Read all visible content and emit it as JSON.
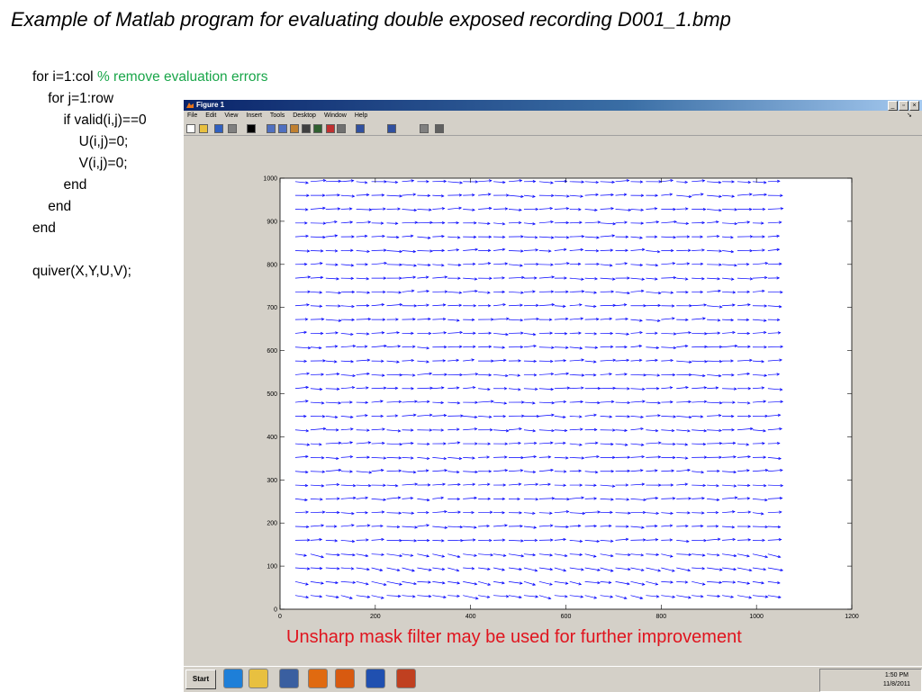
{
  "slide": {
    "title": "Example of Matlab program for evaluating double exposed recording D001_1.bmp",
    "code_lines": [
      {
        "indent": "",
        "text": "for i=1:col ",
        "comment": "% remove evaluation errors"
      },
      {
        "indent": "    ",
        "text": "for j=1:row",
        "comment": ""
      },
      {
        "indent": "        ",
        "text": "if valid(i,j)==0",
        "comment": ""
      },
      {
        "indent": "            ",
        "text": "U(i,j)=0;",
        "comment": ""
      },
      {
        "indent": "            ",
        "text": "V(i,j)=0;",
        "comment": ""
      },
      {
        "indent": "        ",
        "text": "end",
        "comment": ""
      },
      {
        "indent": "    ",
        "text": "end",
        "comment": ""
      },
      {
        "indent": "",
        "text": "end",
        "comment": ""
      },
      {
        "indent": "",
        "text": "",
        "comment": ""
      },
      {
        "indent": "",
        "text": "quiver(X,Y,U,V);",
        "comment": ""
      }
    ],
    "caption": "Unsharp mask filter may be used for further improvement"
  },
  "window": {
    "title": "Figure 1",
    "menu": [
      "File",
      "Edit",
      "View",
      "Insert",
      "Tools",
      "Desktop",
      "Window",
      "Help"
    ],
    "toolbar_icons": [
      "new-figure-icon",
      "open-file-icon",
      "save-icon",
      "print-icon",
      "edit-plot-icon",
      "zoom-in-icon",
      "zoom-out-icon",
      "pan-icon",
      "rotate-3d-icon",
      "data-cursor-icon",
      "brush-icon",
      "link-icon",
      "colorbar-icon",
      "legend-icon",
      "hide-plot-tools-icon",
      "show-plot-tools-icon"
    ]
  },
  "chart_data": {
    "type": "quiver",
    "xlim": [
      0,
      1200
    ],
    "ylim": [
      0,
      1000
    ],
    "xticks": [
      0,
      200,
      400,
      600,
      800,
      1000,
      1200
    ],
    "yticks": [
      0,
      100,
      200,
      300,
      400,
      500,
      600,
      700,
      800,
      900,
      1000
    ],
    "grid_x": {
      "start": 32,
      "step": 32,
      "count": 32
    },
    "grid_y": {
      "start": 32,
      "step": 32,
      "count": 31
    },
    "dominant_direction": "positive x",
    "arrow_color": "#0000ff",
    "grid": false
  },
  "taskbar": {
    "start_label": "Start",
    "apps": [
      "ie-icon",
      "folder-icon",
      "media-player-icon",
      "firefox-icon",
      "matlab-icon",
      "word-icon",
      "powerpoint-icon"
    ],
    "time": "1:50 PM",
    "date": "11/8/2011"
  },
  "colors": {
    "comment": "#1aa64a",
    "caption": "#e0141e",
    "window_chrome": "#d4d0c8",
    "titlebar_start": "#0a246a"
  }
}
